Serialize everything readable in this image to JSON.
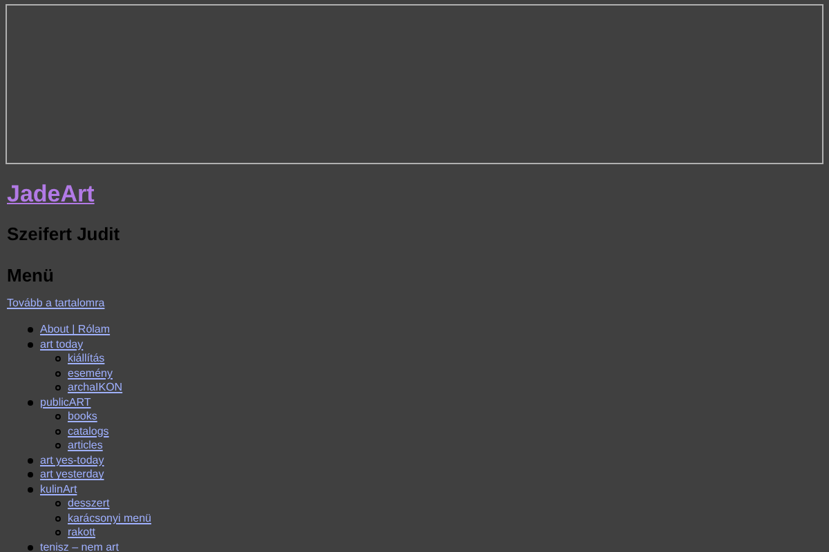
{
  "site_title": "JadeArt",
  "subtitle": "Szeifert Judit",
  "menu_heading": "Menü",
  "skip_link": "Tovább a tartalomra",
  "menu": [
    {
      "label": "About | Rólam"
    },
    {
      "label": "art today",
      "children": [
        {
          "label": "kiállítás"
        },
        {
          "label": "esemény"
        },
        {
          "label": "archaIKON"
        }
      ]
    },
    {
      "label": "publicART",
      "children": [
        {
          "label": "books"
        },
        {
          "label": "catalogs"
        },
        {
          "label": "articles"
        }
      ]
    },
    {
      "label": "art yes-today"
    },
    {
      "label": "art yesterday"
    },
    {
      "label": "kulinArt",
      "children": [
        {
          "label": "desszert"
        },
        {
          "label": "karácsonyi menü"
        },
        {
          "label": "rakott"
        }
      ]
    },
    {
      "label": "tenisz – nem art"
    }
  ]
}
